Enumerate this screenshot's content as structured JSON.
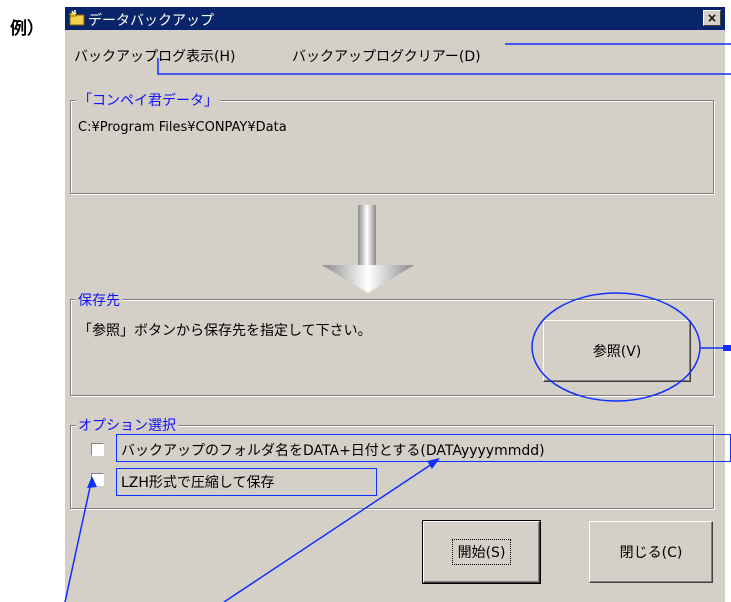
{
  "example_label": "例）",
  "window": {
    "title": "データバックアップ",
    "close_label": "×"
  },
  "menu": [
    "バックアップログ表示(H)",
    "バックアップログクリアー(D)"
  ],
  "source_group": {
    "legend": "「コンペイ君データ」",
    "path": "C:¥Program Files¥CONPAY¥Data"
  },
  "dest_group": {
    "legend": "保存先",
    "hint": "「参照」ボタンから保存先を指定して下さい。",
    "browse_button": "参照(V)"
  },
  "options_group": {
    "legend": "オプション選択",
    "folder_name_option": "バックアップのフォルダ名をDATA+日付とする(DATAyyyymmdd)",
    "lzh_option": "LZH形式で圧縮して保存",
    "folder_name_checked": false,
    "lzh_checked": false
  },
  "buttons": {
    "start": "開始(S)",
    "close": "閉じる(C)"
  },
  "annotation_color": "#1030ff"
}
